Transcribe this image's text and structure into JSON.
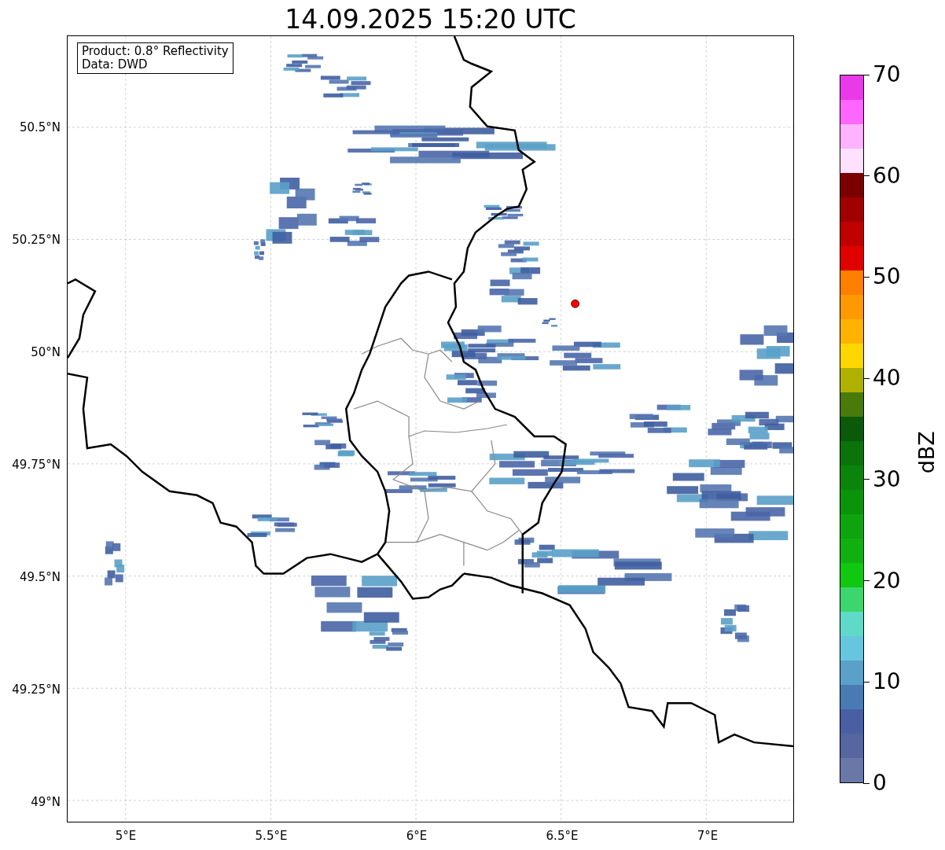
{
  "title": "14.09.2025 15:20 UTC",
  "legend_lines": [
    "Product: 0.8° Reflectivity",
    "Data: DWD"
  ],
  "x_ticks": [
    "5°E",
    "5.5°E",
    "6°E",
    "6.5°E",
    "7°E"
  ],
  "y_ticks": [
    "50.5°N",
    "50.25°N",
    "50°N",
    "49.75°N",
    "49.5°N",
    "49.25°N",
    "49°N"
  ],
  "colorbar": {
    "label": "dBZ",
    "ticks": [
      "70",
      "60",
      "50",
      "40",
      "30",
      "20",
      "10",
      "0"
    ],
    "bins": [
      {
        "color": "#e83ae8"
      },
      {
        "color": "#ff66ff"
      },
      {
        "color": "#ffb3ff"
      },
      {
        "color": "#ffe0ff"
      },
      {
        "color": "#7a0000"
      },
      {
        "color": "#a00000"
      },
      {
        "color": "#c00000"
      },
      {
        "color": "#e00000"
      },
      {
        "color": "#ff7f00"
      },
      {
        "color": "#ff9900"
      },
      {
        "color": "#ffb300"
      },
      {
        "color": "#ffd700"
      },
      {
        "color": "#b0b000"
      },
      {
        "color": "#4a7a0a"
      },
      {
        "color": "#0a5a0a"
      },
      {
        "color": "#0a740a"
      },
      {
        "color": "#0a840a"
      },
      {
        "color": "#0a940a"
      },
      {
        "color": "#0ea40e"
      },
      {
        "color": "#10b010"
      },
      {
        "color": "#10c810"
      },
      {
        "color": "#3cd66e"
      },
      {
        "color": "#5fd9c8"
      },
      {
        "color": "#66c6e0"
      },
      {
        "color": "#5aa0c8"
      },
      {
        "color": "#4a7ab4"
      },
      {
        "color": "#4a5ea4"
      },
      {
        "color": "#5566a0"
      },
      {
        "color": "#6a78a8"
      }
    ]
  }
}
